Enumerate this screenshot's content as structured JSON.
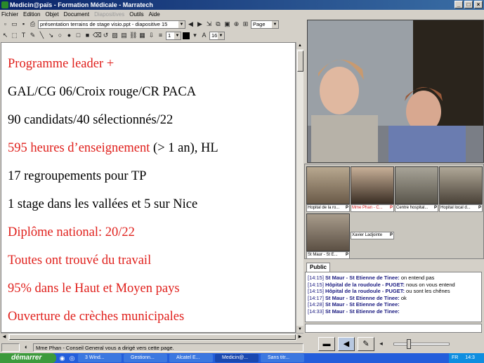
{
  "window": {
    "title": "Medicin@païs - Formation Médicale - Marratech"
  },
  "menu": [
    "Fichier",
    "Edition",
    "Objet",
    "Document",
    "Diapositives",
    "Outils",
    "Aide"
  ],
  "toolbar": {
    "document_select": "présentation terrains de stage visio.ppt - diapositive 15",
    "view_select": "Page",
    "line_width_select": "1",
    "font_size_select": "16"
  },
  "slide": {
    "lines": [
      {
        "text": "Programme leader +",
        "color": "red"
      },
      {
        "text": "GAL/CG 06/Croix rouge/CR PACA",
        "color": "black"
      },
      {
        "text": "90 candidats/40 sélectionnés/22",
        "color": "black"
      },
      {
        "parts": [
          "595 heures d’enseignement",
          " (> 1 an), HL"
        ],
        "color": "mixed"
      },
      {
        "text": "17 regroupements pour TP",
        "color": "black"
      },
      {
        "text": "1 stage dans les vallées et 5 sur Nice",
        "color": "black"
      },
      {
        "text": "Diplôme national: 20/22",
        "color": "red"
      },
      {
        "text": "Toutes ont trouvé du travail",
        "color": "red"
      },
      {
        "text": "95% dans le Haut et Moyen pays",
        "color": "red"
      },
      {
        "text": "Ouverture de crèches municipales",
        "color": "red"
      }
    ]
  },
  "status_bar": {
    "message": "Mme Phan - Conseil General vous a dirigé vers cette page."
  },
  "participants": [
    {
      "label": "Hopital de la ro...",
      "badge": "P"
    },
    {
      "label": "Mme Phan - C...",
      "badge": "P"
    },
    {
      "label": "Centre hospital...",
      "badge": "P"
    },
    {
      "label": "Hopital local d...",
      "badge": "P"
    },
    {
      "label": "St Maur - St E...",
      "badge": "P"
    }
  ],
  "named_box": {
    "label": "Xavier Ladjointe",
    "badge": "P"
  },
  "chat": {
    "tab": "Public",
    "messages": [
      {
        "time": "[14:15]",
        "who": "St Maur - St Etienne de Tinee:",
        "msg": "on entend pas"
      },
      {
        "time": "[14:15]",
        "who": "Hôpital de la roudoule - PUGET:",
        "msg": "nous on vous entend"
      },
      {
        "time": "[14:15]",
        "who": "Hôpital de la roudoule - PUGET:",
        "msg": "ou sont les chênes"
      },
      {
        "time": "[14:17]",
        "who": "St Maur - St Etienne de Tinee:",
        "msg": "ok"
      },
      {
        "time": "[14:28]",
        "who": "St Maur - St Etienne de Tinee:",
        "msg": ""
      },
      {
        "time": "[14:33]",
        "who": "St Maur - St Etienne de Tinee:",
        "msg": ""
      }
    ]
  },
  "taskbar": {
    "start": "démarrer",
    "items": [
      "3 Wind...",
      "Gestionn...",
      "Alcatel E...",
      "Medicin@...",
      "Sans titr..."
    ],
    "tray_lang": "FR",
    "clock": "14:3"
  }
}
